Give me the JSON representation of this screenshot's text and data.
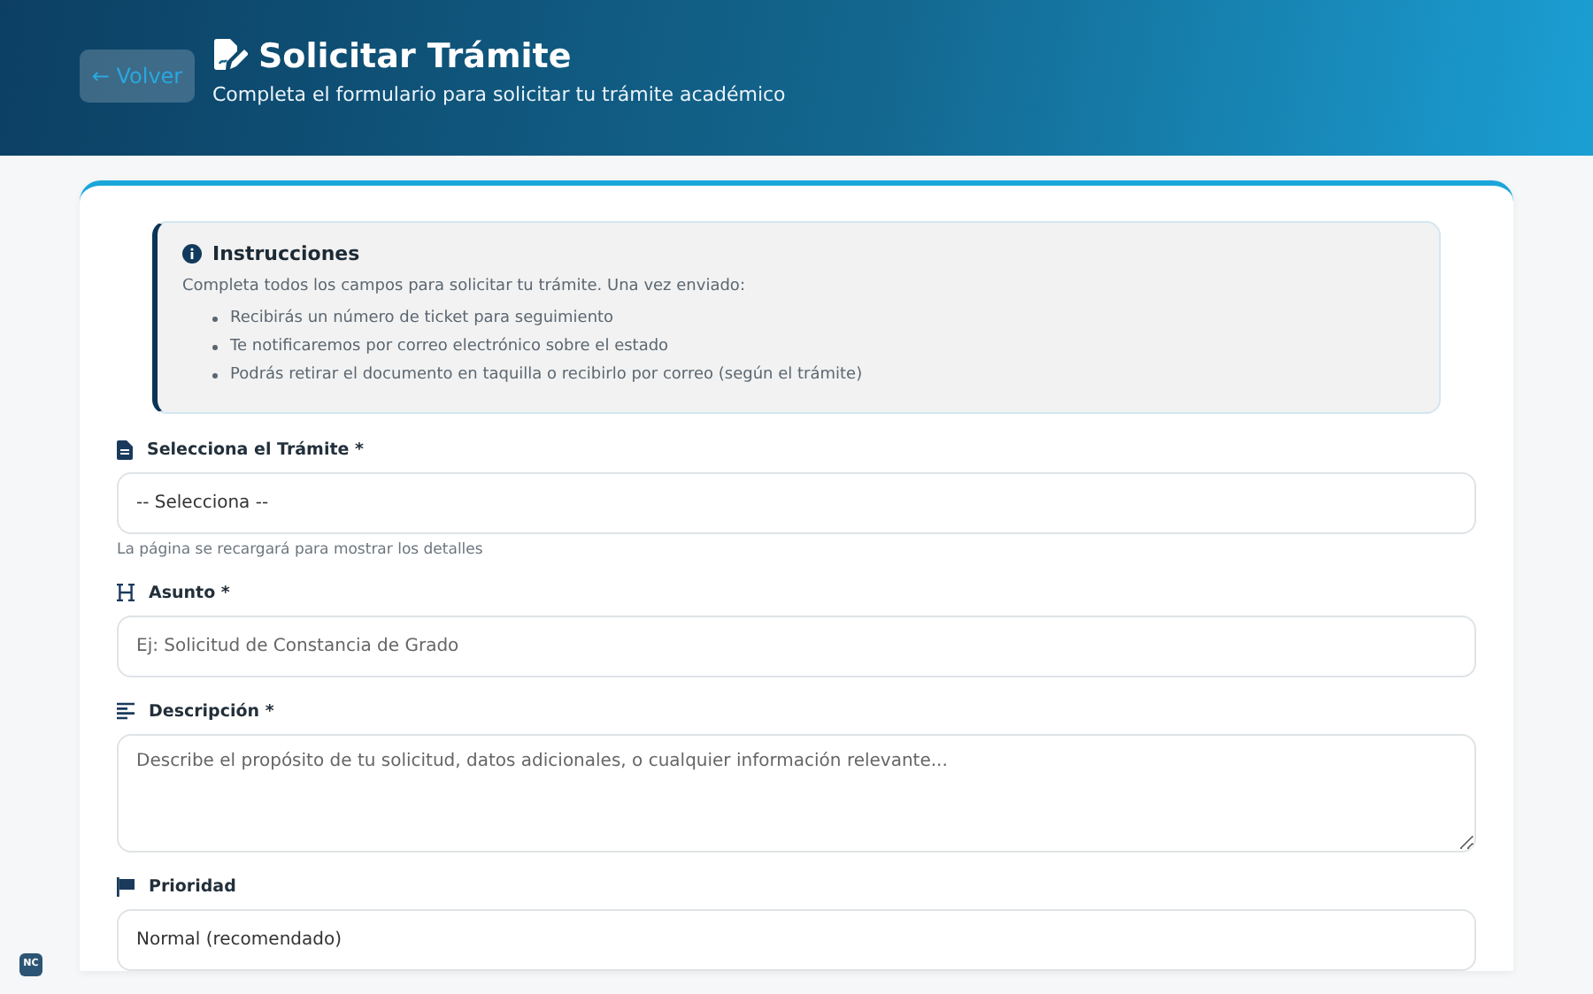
{
  "header": {
    "back_button": "← Volver",
    "title": "Solicitar Trámite",
    "subtitle": "Completa el formulario para solicitar tu trámite académico"
  },
  "instructions": {
    "title": "Instrucciones",
    "intro": "Completa todos los campos para solicitar tu trámite. Una vez enviado:",
    "items": [
      "Recibirás un número de ticket para seguimiento",
      "Te notificaremos por correo electrónico sobre el estado",
      "Podrás retirar el documento en taquilla o recibirlo por correo (según el trámite)"
    ]
  },
  "fields": [
    {
      "kind": "select",
      "label": "Selecciona el Trámite *",
      "value": "-- Selecciona --",
      "hint": "La página se recargará para mostrar los detalles"
    },
    {
      "kind": "input",
      "label": "Asunto *",
      "placeholder": "Ej: Solicitud de Constancia de Grado"
    },
    {
      "kind": "textarea",
      "label": "Descripción *",
      "placeholder": "Describe el propósito de tu solicitud, datos adicionales, o cualquier información relevante..."
    },
    {
      "kind": "select",
      "label": "Prioridad",
      "value": "Normal (recomendado)"
    }
  ],
  "corner_badge": "NC"
}
